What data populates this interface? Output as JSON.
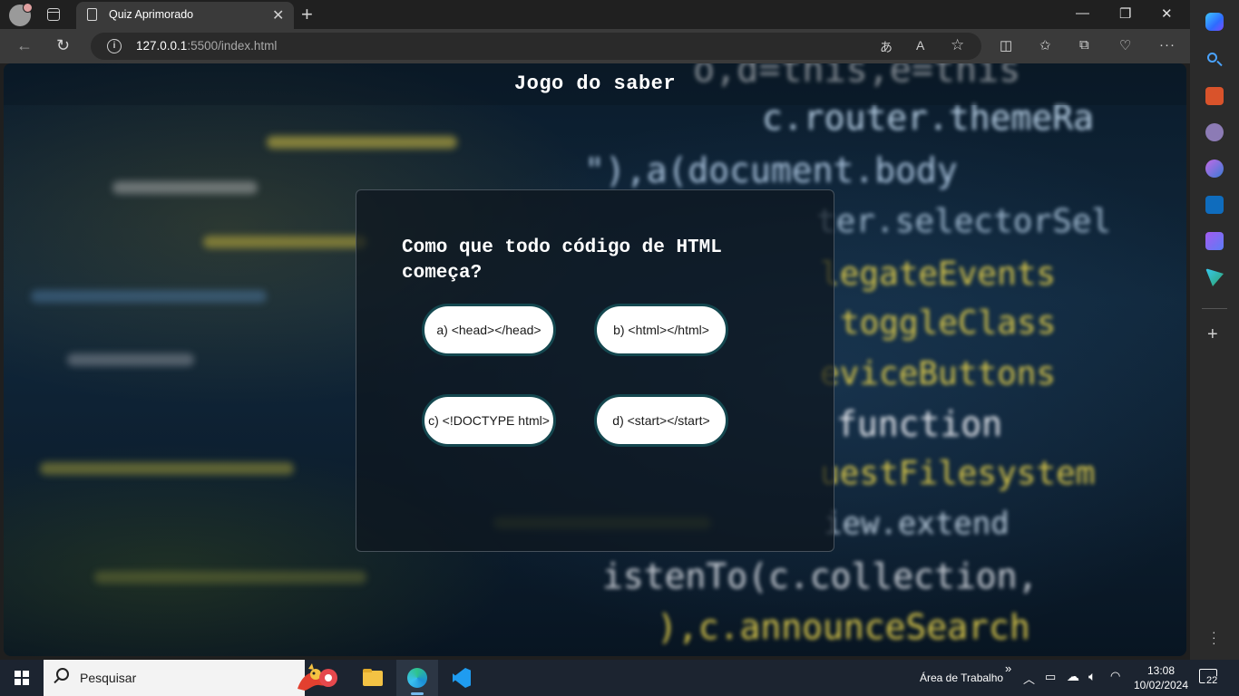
{
  "browser": {
    "tab_title": "Quiz Aprimorado",
    "url_host": "127.0.0.1",
    "url_rest": ":5500/index.html"
  },
  "page": {
    "title": "Jogo do saber",
    "question": "Como que todo código de HTML começa?",
    "answers": [
      "a) <head></head>",
      "b) <html></html>",
      "c) <!DOCTYPE html>",
      "d) <start></start>"
    ]
  },
  "taskbar": {
    "search_placeholder": "Pesquisar",
    "desktop_label": "Área de Trabalho",
    "time": "13:08",
    "date": "10/02/2024",
    "notification_count": "22"
  },
  "background_code": {
    "lines": [
      "o,d=this,e=this",
      "c.router.themeRa",
      "\"),a(document.body",
      "ter.selectorSel",
      "legateEvents",
      "toggleClass",
      "eviceButtons",
      "function",
      "uestFilesystem",
      "iew.extend",
      "istenTo(c.collection,",
      "),c.announceSearch"
    ]
  },
  "colors": {
    "answer_border": "#14474f",
    "accent": "#76b9ed"
  }
}
